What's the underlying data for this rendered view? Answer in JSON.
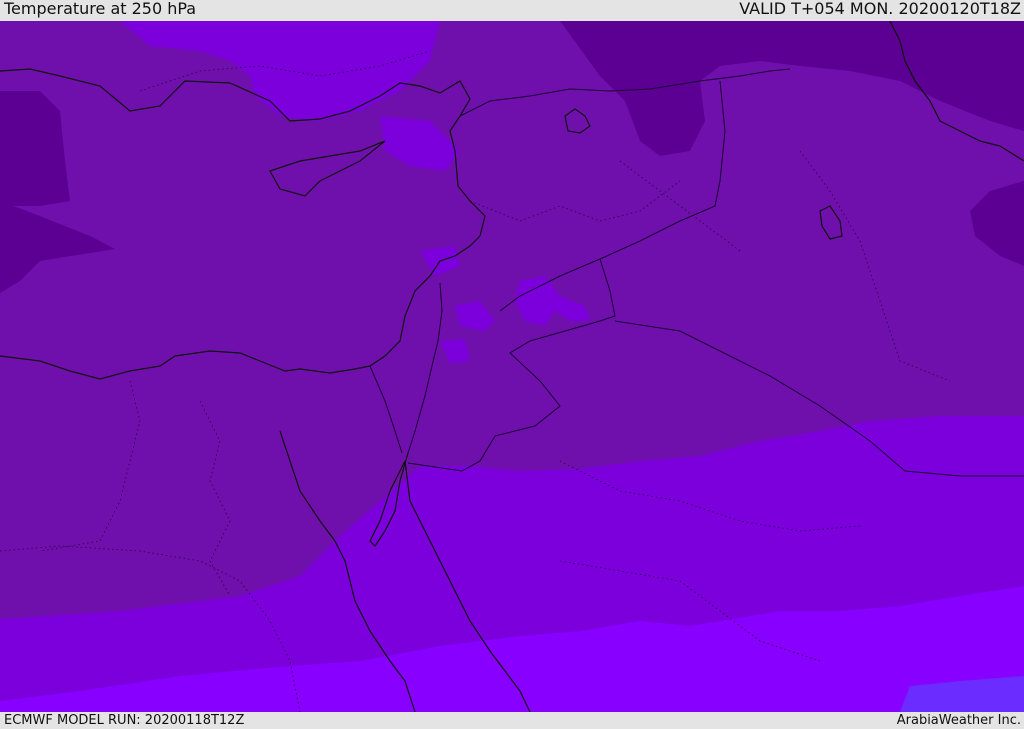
{
  "header": {
    "title": "Temperature at 250 hPa",
    "valid_time": "VALID T+054 MON. 20200120T18Z"
  },
  "footer": {
    "model_run": "ECMWF MODEL RUN: 20200118T12Z",
    "credit": "ArabiaWeather Inc."
  },
  "map": {
    "colors": {
      "coldest": "#5c0094",
      "cold": "#7010ac",
      "cool": "#7c00dc",
      "mild": "#8800ff",
      "warm": "#6a2cff",
      "coastline": "#111111",
      "border": "#1a0033"
    }
  }
}
